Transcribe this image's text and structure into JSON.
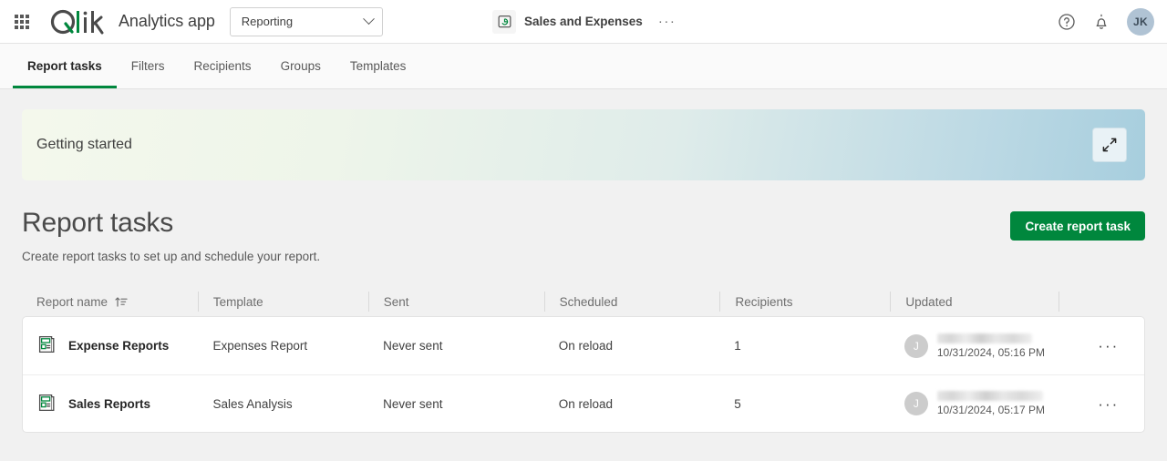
{
  "header": {
    "launcher_label": "grid-launcher",
    "brand": "Qlik",
    "app_title": "Analytics app",
    "section_select": {
      "value": "Reporting"
    },
    "document": {
      "name": "Sales and Expenses",
      "kebab": "···"
    },
    "help_label": "help-icon",
    "notifications_label": "notifications-icon",
    "avatar_initials": "JK"
  },
  "tabs": [
    {
      "label": "Report tasks",
      "active": true
    },
    {
      "label": "Filters",
      "active": false
    },
    {
      "label": "Recipients",
      "active": false
    },
    {
      "label": "Groups",
      "active": false
    },
    {
      "label": "Templates",
      "active": false
    }
  ],
  "banner": {
    "title": "Getting started",
    "expand_icon": "expand-icon"
  },
  "page": {
    "title": "Report tasks",
    "subtitle": "Create report tasks to set up and schedule your report.",
    "create_button": "Create report task"
  },
  "table": {
    "columns": [
      {
        "label": "Report name",
        "sorted": true,
        "sort_dir": "asc"
      },
      {
        "label": "Template"
      },
      {
        "label": "Sent"
      },
      {
        "label": "Scheduled"
      },
      {
        "label": "Recipients"
      },
      {
        "label": "Updated"
      },
      {
        "label": ""
      }
    ],
    "rows": [
      {
        "name": "Expense Reports",
        "template": "Expenses Report",
        "sent": "Never sent",
        "scheduled": "On reload",
        "recipients": "1",
        "updated_by_initial": "J",
        "updated_by_name": "",
        "updated_time": "10/31/2024, 05:16 PM",
        "actions": "···"
      },
      {
        "name": "Sales Reports",
        "template": "Sales Analysis",
        "sent": "Never sent",
        "scheduled": "On reload",
        "recipients": "5",
        "updated_by_initial": "J",
        "updated_by_name": "",
        "updated_time": "10/31/2024, 05:17 PM",
        "actions": "···"
      }
    ]
  },
  "colors": {
    "brand_green": "#00873d",
    "page_bg": "#f1f1f1",
    "text": "#404040"
  }
}
